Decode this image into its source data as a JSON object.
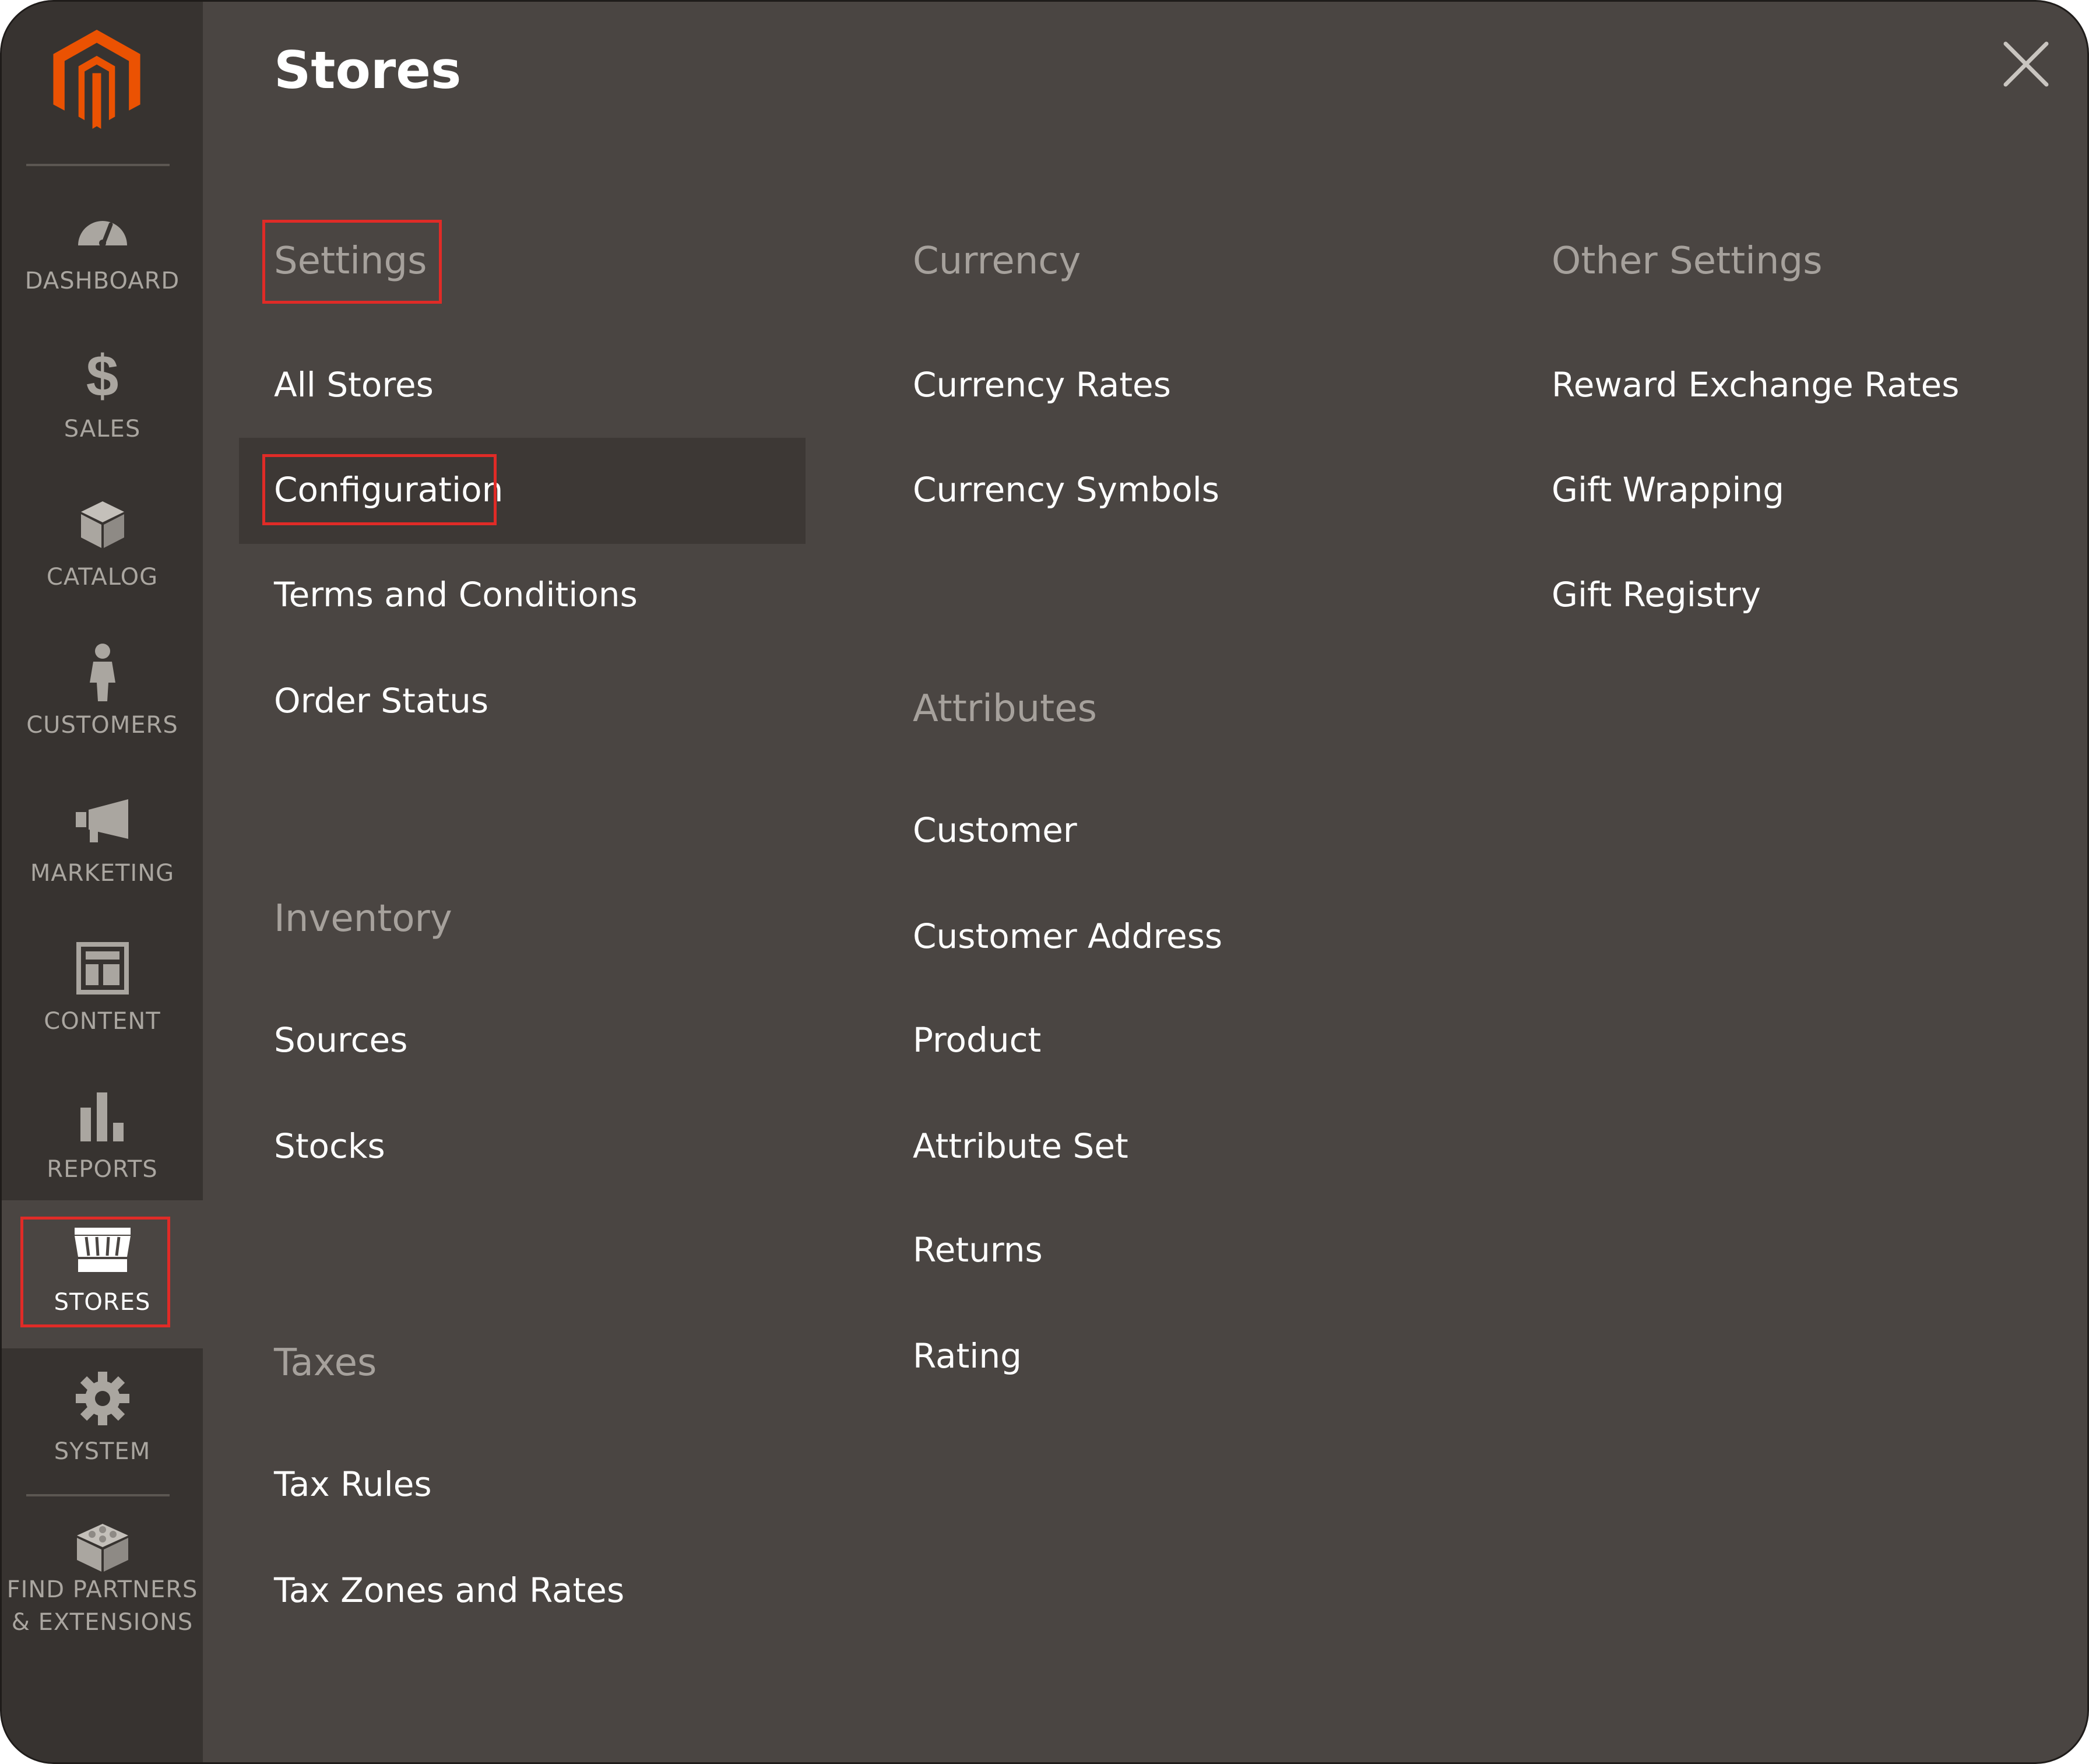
{
  "sidebar": {
    "logo": "magento-logo",
    "items": [
      {
        "label": "DASHBOARD",
        "icon": "dashboard-gauge-icon"
      },
      {
        "label": "SALES",
        "icon": "dollar-icon"
      },
      {
        "label": "CATALOG",
        "icon": "box-icon"
      },
      {
        "label": "CUSTOMERS",
        "icon": "person-icon"
      },
      {
        "label": "MARKETING",
        "icon": "megaphone-icon"
      },
      {
        "label": "CONTENT",
        "icon": "layout-icon"
      },
      {
        "label": "REPORTS",
        "icon": "bar-chart-icon"
      },
      {
        "label": "STORES",
        "icon": "storefront-icon",
        "active": true
      },
      {
        "label": "SYSTEM",
        "icon": "gear-icon"
      },
      {
        "label_line1": "FIND PARTNERS",
        "label_line2": "& EXTENSIONS",
        "icon": "blocks-icon"
      }
    ]
  },
  "panel": {
    "title": "Stores",
    "close_icon": "close-icon",
    "columns": [
      {
        "groups": [
          {
            "title": "Settings",
            "items": [
              "All Stores",
              "Configuration",
              "Terms and Conditions",
              "Order Status"
            ]
          },
          {
            "title": "Inventory",
            "items": [
              "Sources",
              "Stocks"
            ]
          },
          {
            "title": "Taxes",
            "items": [
              "Tax Rules",
              "Tax Zones and Rates"
            ]
          }
        ]
      },
      {
        "groups": [
          {
            "title": "Currency",
            "items": [
              "Currency Rates",
              "Currency Symbols"
            ]
          },
          {
            "title": "Attributes",
            "items": [
              "Customer",
              "Customer Address",
              "Product",
              "Attribute Set",
              "Returns",
              "Rating"
            ]
          }
        ]
      },
      {
        "groups": [
          {
            "title": "Other Settings",
            "items": [
              "Reward Exchange Rates",
              "Gift Wrapping",
              "Gift Registry"
            ]
          }
        ]
      }
    ]
  },
  "colors": {
    "sidebar_bg": "#373330",
    "panel_bg": "#4a4542",
    "highlight_bg": "#3d3835",
    "accent_orange": "#eb5202",
    "annotation_red": "#e02b27",
    "group_title": "#a6a19c",
    "link_text": "#ffffff"
  }
}
